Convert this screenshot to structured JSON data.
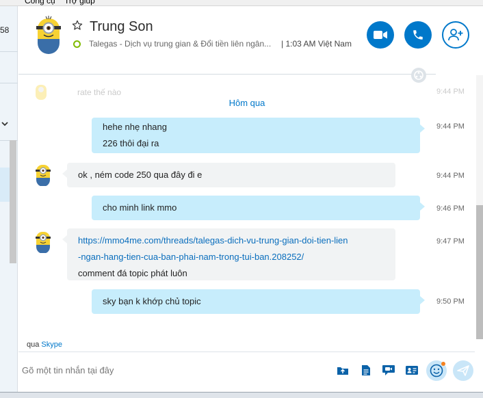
{
  "menu": {
    "items": [
      "Công cụ",
      "Trợ giúp"
    ]
  },
  "sidebar": {
    "number": "58"
  },
  "header": {
    "contact_name": "Trung Son",
    "mood": "Talegas - Dịch vụ trung gian & Đổi tiền liên ngân...",
    "local_time": "| 1:03 AM Việt Nam",
    "presence_color": "#7fba00",
    "accent_color": "#0078ca"
  },
  "conversation": {
    "faded": {
      "text": "rate thế nào",
      "time": "9:44 PM"
    },
    "date_separator": "Hôm qua",
    "messages": [
      {
        "direction": "out",
        "lines": [
          "hehe nhẹ nhang",
          "226 thôi đại ra"
        ],
        "time": "9:44 PM"
      },
      {
        "direction": "in",
        "lines": [
          "ok , ném code 250 qua đây đi e"
        ],
        "time": "9:44 PM"
      },
      {
        "direction": "out",
        "lines": [
          "cho minh link mmo"
        ],
        "time": "9:46 PM"
      },
      {
        "direction": "in",
        "link_lines": [
          "https://mmo4me.com/threads/talegas-dich-vu-trung-gian-doi-tien-lien",
          "-ngan-hang-tien-cua-ban-phai-nam-trong-tui-ban.208252/"
        ],
        "lines": [
          "comment đá topic phát luôn"
        ],
        "time": "9:47 PM"
      },
      {
        "direction": "out",
        "lines": [
          "sky bạn k khớp chủ topic"
        ],
        "time": "9:50 PM"
      }
    ]
  },
  "footer": {
    "via_label": "qua",
    "via_app": "Skype",
    "input_placeholder": "Gõ một tin nhắn tại đây"
  },
  "icons": {
    "star": "star-icon",
    "video": "video-camera-icon",
    "call": "phone-icon",
    "add_people": "add-person-icon",
    "share": "share-icon",
    "send_file": "send-file-icon",
    "document": "document-icon",
    "video_message": "video-message-icon",
    "contact_card": "contact-card-icon",
    "emoji": "emoji-icon",
    "send": "send-icon"
  }
}
